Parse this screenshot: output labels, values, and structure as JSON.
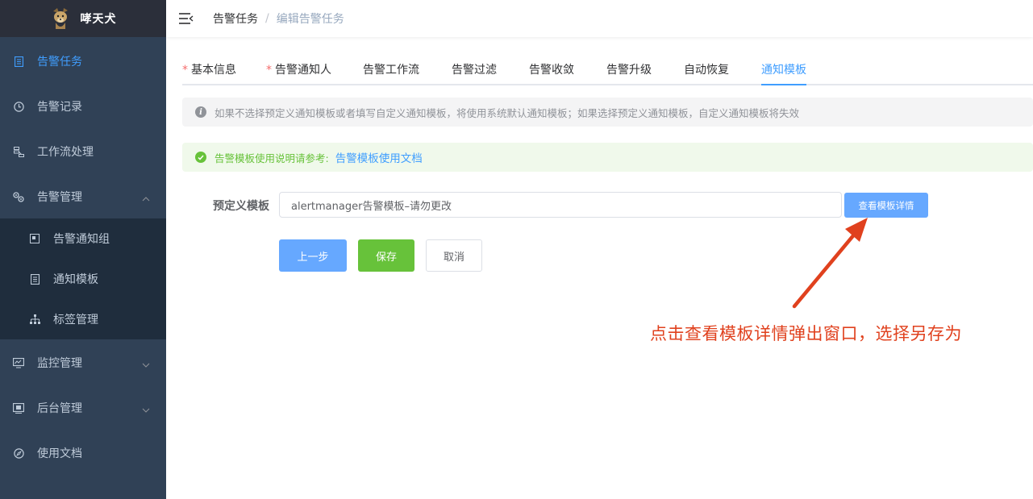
{
  "app": {
    "title": "哮天犬"
  },
  "sidebar": {
    "items": [
      {
        "label": "告警任务",
        "icon": "document-icon",
        "active": true
      },
      {
        "label": "告警记录",
        "icon": "clock-icon",
        "active": false
      },
      {
        "label": "工作流处理",
        "icon": "workflow-icon",
        "active": false
      },
      {
        "label": "告警管理",
        "icon": "gears-icon",
        "active": false,
        "expanded": true
      },
      {
        "label": "监控管理",
        "icon": "monitor-icon",
        "active": false,
        "expanded": false
      },
      {
        "label": "后台管理",
        "icon": "admin-icon",
        "active": false,
        "expanded": false
      },
      {
        "label": "使用文档",
        "icon": "compass-icon",
        "active": false
      }
    ],
    "submenu": [
      {
        "label": "告警通知组",
        "icon": "group-icon"
      },
      {
        "label": "通知模板",
        "icon": "template-icon"
      },
      {
        "label": "标签管理",
        "icon": "tree-icon"
      }
    ]
  },
  "breadcrumb": {
    "items": [
      "告警任务",
      "编辑告警任务"
    ],
    "separator": "/"
  },
  "tabs": [
    {
      "label": "基本信息",
      "required": true
    },
    {
      "label": "告警通知人",
      "required": true
    },
    {
      "label": "告警工作流",
      "required": false
    },
    {
      "label": "告警过滤",
      "required": false
    },
    {
      "label": "告警收敛",
      "required": false
    },
    {
      "label": "告警升级",
      "required": false
    },
    {
      "label": "自动恢复",
      "required": false
    },
    {
      "label": "通知模板",
      "required": false,
      "active": true
    }
  ],
  "info_alert": {
    "text": "如果不选择预定义通知模板或者填写自定义通知模板，将使用系统默认通知模板；如果选择预定义通知模板，自定义通知模板将失效"
  },
  "success_alert": {
    "text": "告警模板使用说明请参考:",
    "link": "告警模板使用文档"
  },
  "form": {
    "template_label": "预定义模板",
    "template_value": "alertmanager告警模板–请勿更改",
    "detail_button": "查看模板详情",
    "prev_button": "上一步",
    "save_button": "保存",
    "cancel_button": "取消"
  },
  "annotation": {
    "text": "点击查看模板详情弹出窗口，选择另存为"
  },
  "colors": {
    "sidebar_bg": "#304156",
    "submenu_bg": "#1f2d3d",
    "primary": "#409eff",
    "success": "#67c23a",
    "annotation": "#e0411e"
  }
}
